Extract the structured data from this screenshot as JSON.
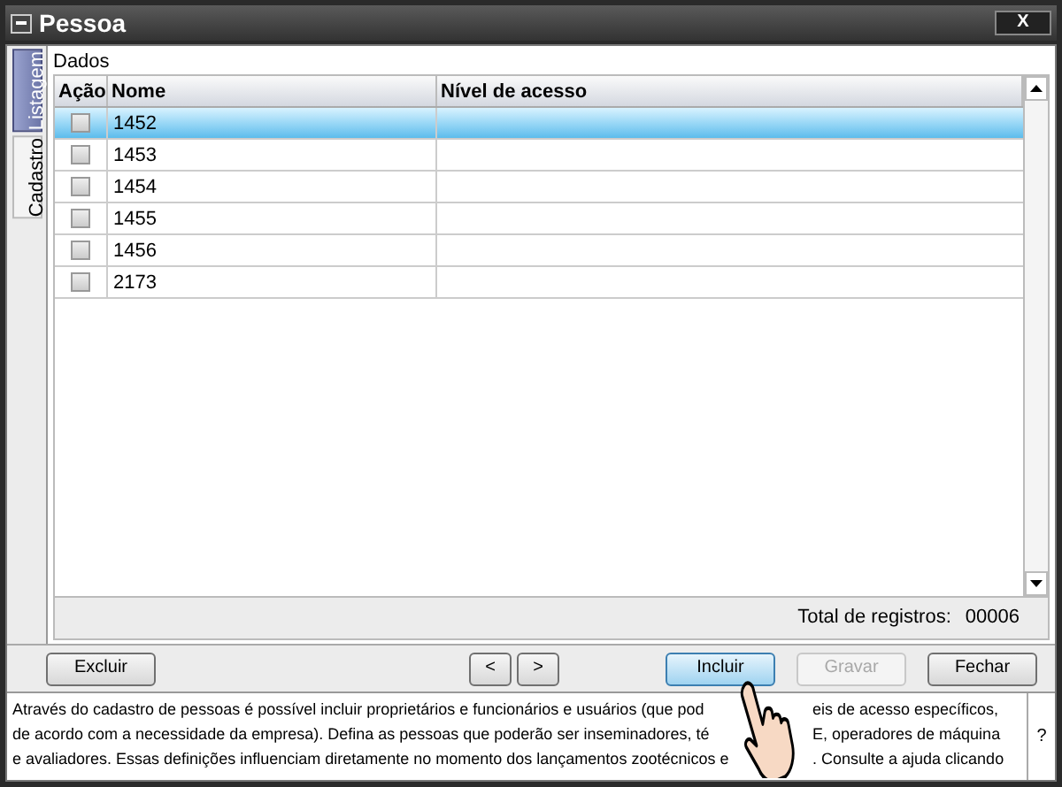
{
  "window": {
    "title": "Pessoa",
    "close": "X"
  },
  "side_tabs": [
    {
      "label": "Listagem",
      "selected": true
    },
    {
      "label": "Cadastro",
      "selected": false
    }
  ],
  "group_label": "Dados",
  "table": {
    "columns": [
      "Ação",
      "Nome",
      "Nível de acesso"
    ],
    "rows": [
      {
        "checked": false,
        "nome": "1452",
        "selected": true
      },
      {
        "checked": false,
        "nome": "1453",
        "selected": false
      },
      {
        "checked": false,
        "nome": "1454",
        "selected": false
      },
      {
        "checked": false,
        "nome": "1455",
        "selected": false
      },
      {
        "checked": false,
        "nome": "1456",
        "selected": false
      },
      {
        "checked": false,
        "nome": "2173",
        "selected": false
      }
    ]
  },
  "total": {
    "label": "Total de registros:",
    "value": "00006"
  },
  "buttons": [
    {
      "label": "Excluir",
      "kind": "wide",
      "disabled": false,
      "focused": false
    },
    {
      "label": "<",
      "kind": "arrow",
      "disabled": false,
      "focused": false
    },
    {
      "label": ">",
      "kind": "arrow",
      "disabled": false,
      "focused": false
    },
    {
      "label": "Incluir",
      "kind": "wide",
      "disabled": false,
      "focused": true
    },
    {
      "label": "Gravar",
      "kind": "wide",
      "disabled": true,
      "focused": false
    },
    {
      "label": "Fechar",
      "kind": "wide",
      "disabled": false,
      "focused": false
    }
  ],
  "help": {
    "lines": [
      [
        "Através do cadastro de pessoas é possível incluir proprietários e funcionários e usuários (que pod",
        "eis de acesso específicos,"
      ],
      [
        "de acordo com a necessidade da empresa). Defina as pessoas que poderão ser inseminadores, té",
        "E, operadores de máquina"
      ],
      [
        "e avaliadores. Essas definições influenciam diretamente no momento dos lançamentos zootécnicos e",
        ". Consulte a ajuda clicando"
      ]
    ],
    "help_button": "?"
  }
}
